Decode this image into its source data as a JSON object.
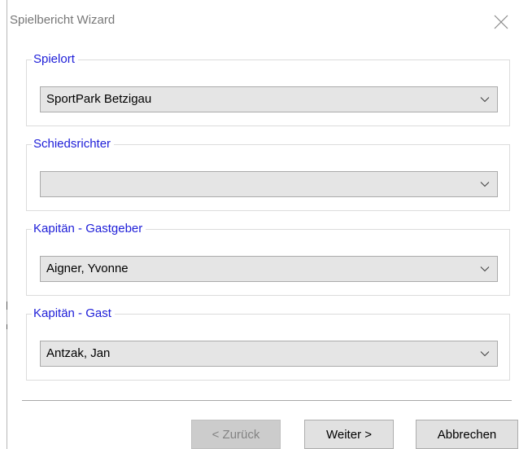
{
  "window": {
    "title": "Spielbericht Wizard",
    "close_icon": "close-icon"
  },
  "groups": [
    {
      "label": "Spielort",
      "value": "SportPark Betzigau"
    },
    {
      "label": "Schiedsrichter",
      "value": ""
    },
    {
      "label": "Kapitän - Gastgeber",
      "value": "Aigner, Yvonne"
    },
    {
      "label": "Kapitän - Gast",
      "value": "Antzak, Jan"
    }
  ],
  "buttons": {
    "back": {
      "label": "< Zurück",
      "enabled": false
    },
    "next": {
      "label": "Weiter >",
      "enabled": true
    },
    "cancel": {
      "label": "Abbrechen",
      "enabled": true
    }
  },
  "colors": {
    "legend": "#1d1dd8",
    "title": "#777777",
    "combo_bg": "#e5e5e5",
    "button_bg": "#e1e1e1",
    "button_disabled_bg": "#cccccc"
  }
}
